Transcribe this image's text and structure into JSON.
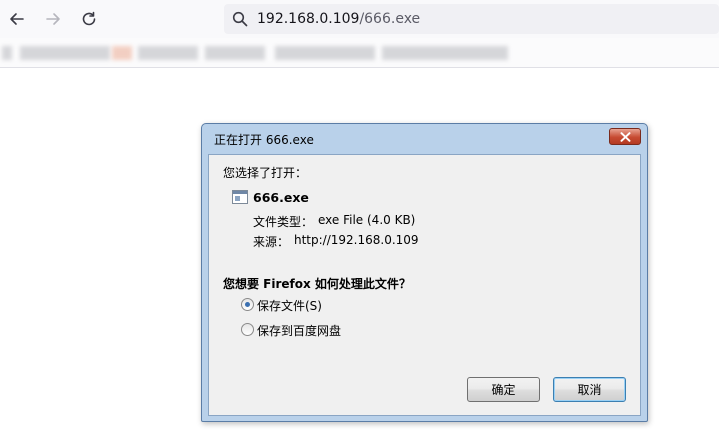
{
  "browser": {
    "url_host": "192.168.0.109",
    "url_path": "/666.exe"
  },
  "dialog": {
    "title": "正在打开 666.exe",
    "you_chose_label": "您选择了打开：",
    "file_name": "666.exe",
    "type_label": "文件类型：",
    "type_value": "exe File (4.0 KB)",
    "source_label": "来源：",
    "source_value": "http://192.168.0.109",
    "question": "您想要 Firefox 如何处理此文件？",
    "options": [
      {
        "label": "保存文件(S)",
        "checked": true
      },
      {
        "label": "保存到百度网盘",
        "checked": false
      }
    ],
    "ok_label": "确定",
    "cancel_label": "取消"
  },
  "colors": {
    "dialog_frame": "#b9d1ea",
    "close_button": "#c74b32",
    "radio_selected": "#3a6fb0"
  }
}
